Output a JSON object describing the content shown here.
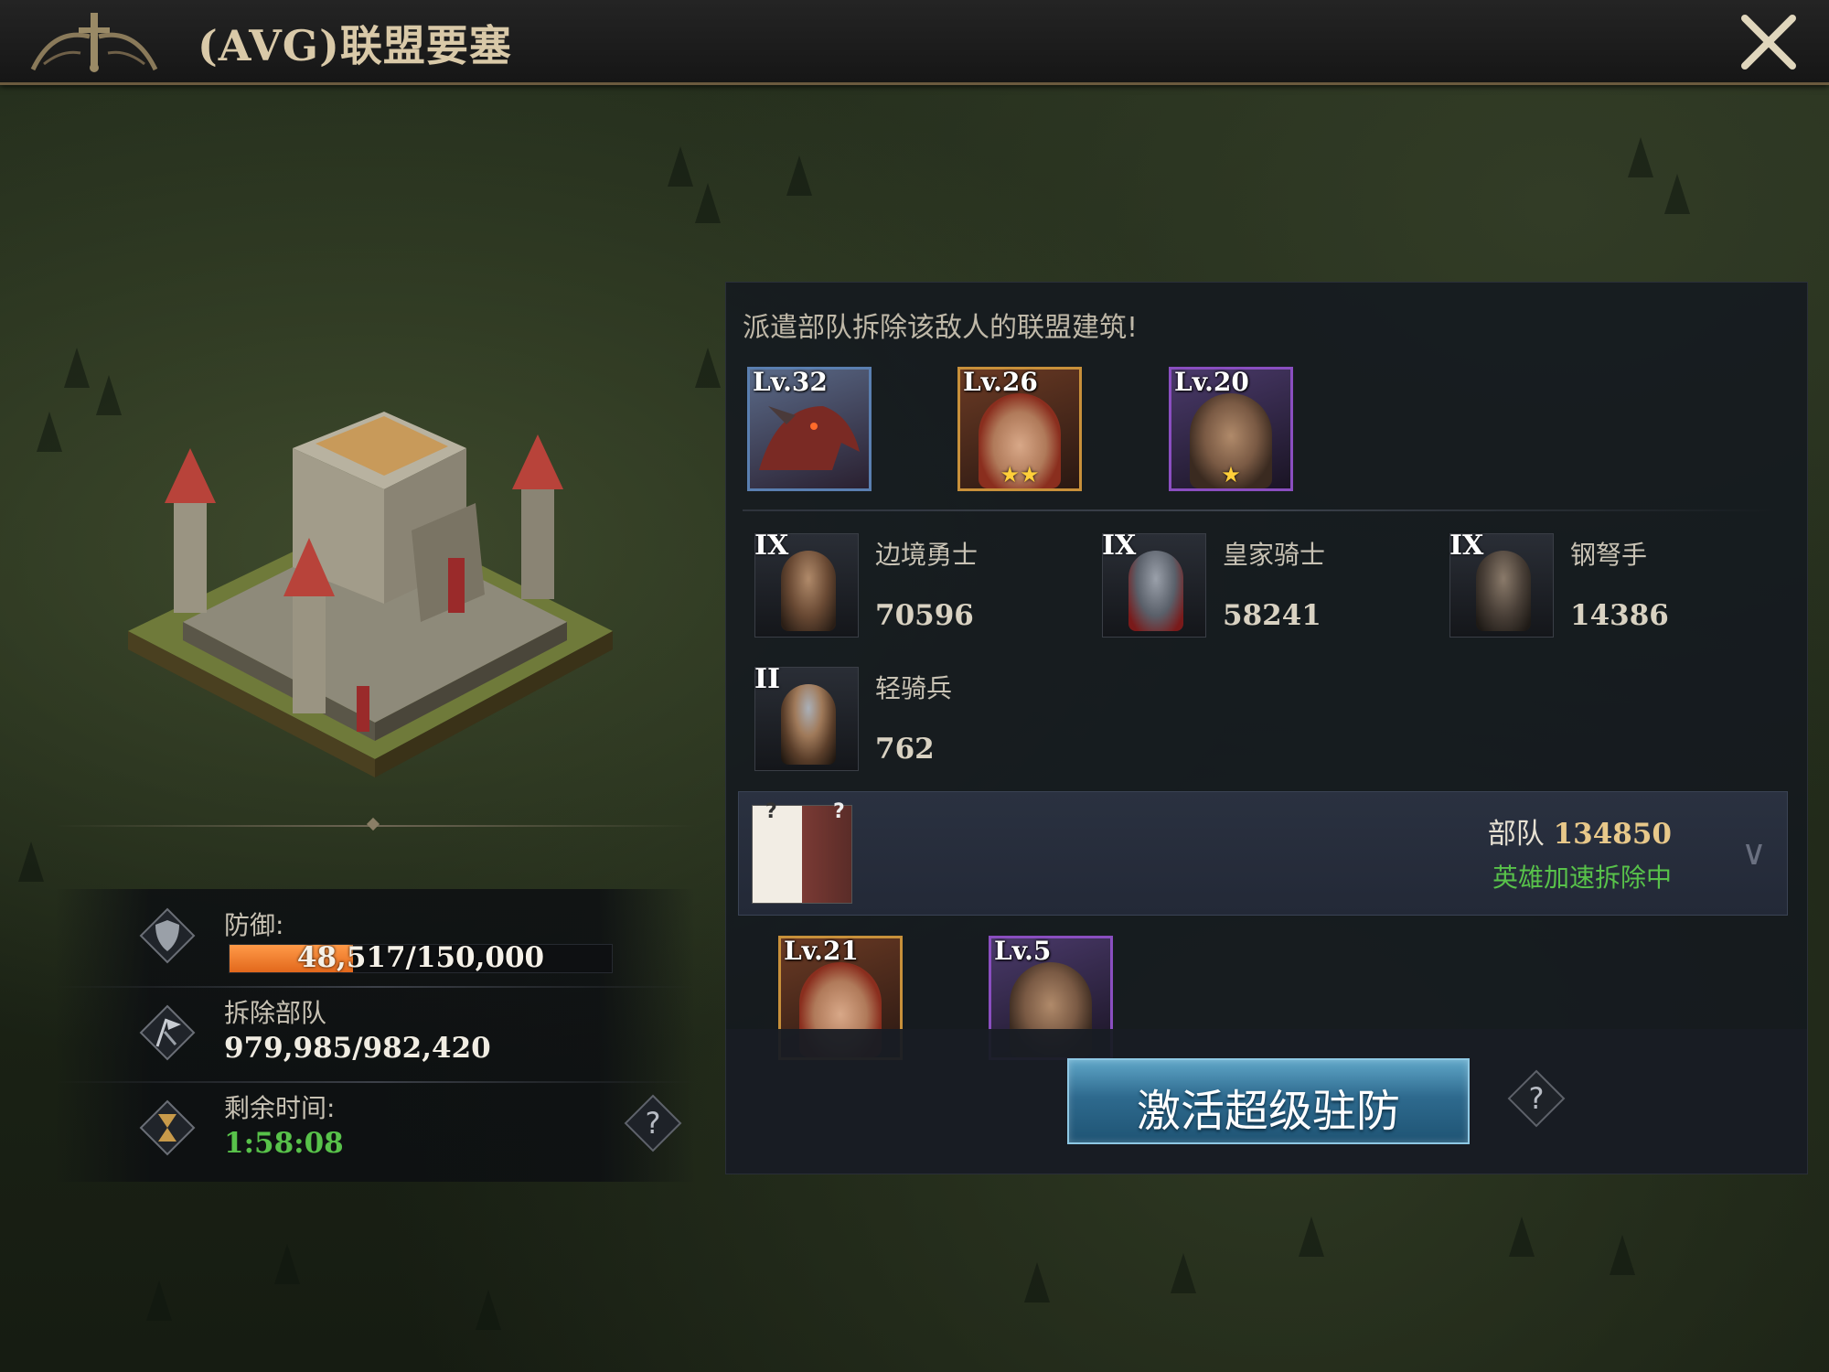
{
  "header": {
    "title": "(AVG)联盟要塞",
    "emblem_icon": "crossed-swords-emblem-icon",
    "close_icon": "close-icon"
  },
  "colors": {
    "accent_gold": "#d9c9a8",
    "progress_orange": "#f07a2a",
    "status_green": "#58c24a",
    "button_blue": "#2e6a8e",
    "troop_count_gold": "#e8c88a"
  },
  "stats": {
    "defense": {
      "label": "防御:",
      "value_text": "48,517/150,000",
      "current": 48517,
      "max": 150000,
      "fill_fraction": 0.3234,
      "icon": "shield-icon"
    },
    "demolish": {
      "label": "拆除部队",
      "value": "979,985/982,420",
      "icon": "flag-demolish-icon"
    },
    "remaining": {
      "label": "剩余时间:",
      "value": "1:58:08",
      "icon": "hourglass-icon",
      "help_icon": "help-icon"
    }
  },
  "panel": {
    "instruction": "派遣部队拆除该敌人的联盟建筑!",
    "heroes": [
      {
        "level": "Lv.32",
        "stars": "",
        "frame": "blue",
        "portrait": "dragon-portrait-icon"
      },
      {
        "level": "Lv.26",
        "stars": "★★",
        "frame": "gold",
        "portrait": "red-haired-heroine-portrait-icon"
      },
      {
        "level": "Lv.20",
        "stars": "★",
        "frame": "purple",
        "portrait": "bearded-warrior-portrait-icon"
      }
    ],
    "troops": [
      {
        "tier": "IX",
        "name": "边境勇士",
        "count": "70596",
        "portrait": "frontier-warrior-icon"
      },
      {
        "tier": "IX",
        "name": "皇家骑士",
        "count": "58241",
        "portrait": "royal-knight-icon"
      },
      {
        "tier": "IX",
        "name": "钢弩手",
        "count": "14386",
        "portrait": "crossbowman-icon"
      },
      {
        "tier": "II",
        "name": "轻骑兵",
        "count": "762",
        "portrait": "light-cavalry-icon"
      }
    ],
    "march": {
      "avatar_marks": "?",
      "troops_label": "部队",
      "troops_count": "134850",
      "status": "英雄加速拆除中",
      "chevron_icon": "chevron-down-icon"
    },
    "march_heroes": [
      {
        "level": "Lv.21",
        "frame": "gold",
        "portrait": "red-haired-heroine-portrait-icon"
      },
      {
        "level": "Lv.5",
        "frame": "purple",
        "portrait": "bearded-warrior-portrait-icon"
      }
    ],
    "activate_button": "激活超级驻防",
    "help_icon": "help-icon"
  }
}
